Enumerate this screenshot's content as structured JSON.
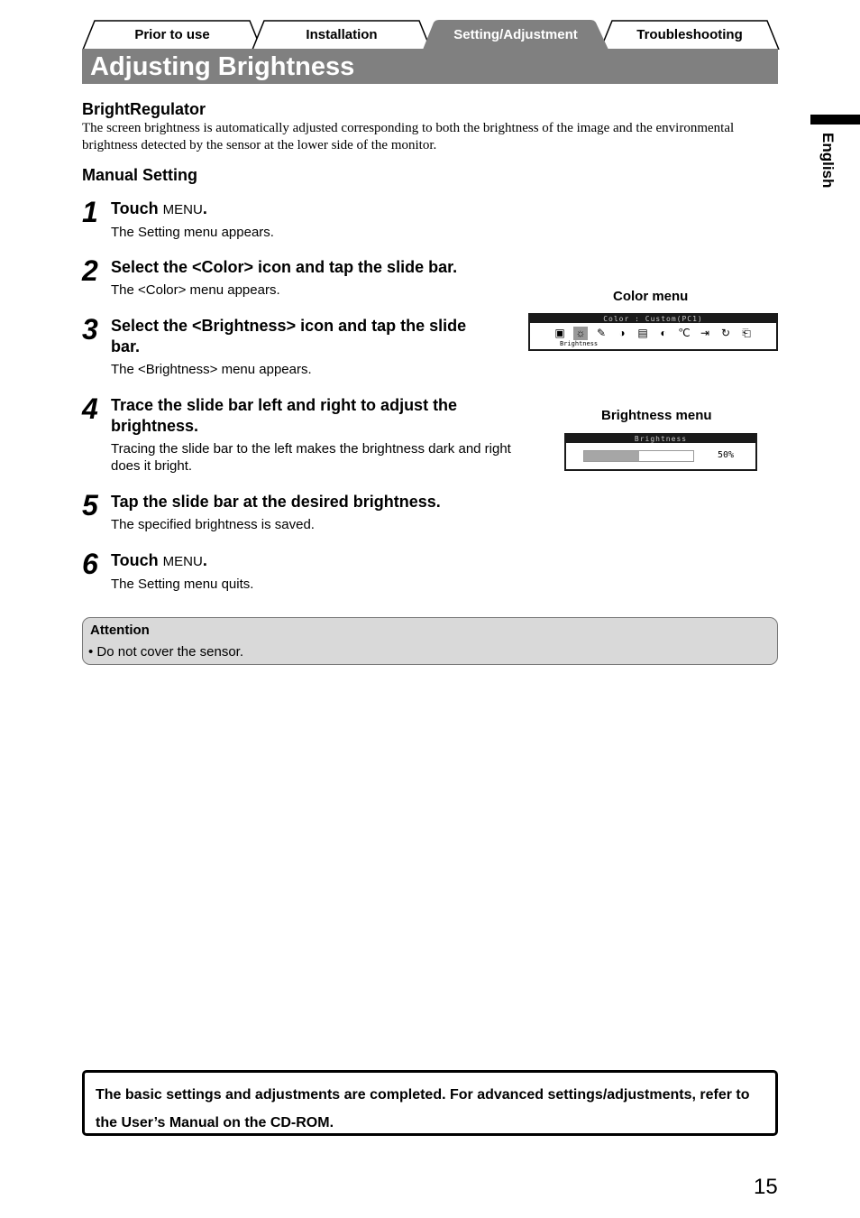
{
  "tabs": [
    {
      "label": "Prior to use",
      "active": false
    },
    {
      "label": "Installation",
      "active": false
    },
    {
      "label": "Setting/Adjustment",
      "active": true
    },
    {
      "label": "Troubleshooting",
      "active": false
    }
  ],
  "page_title": "Adjusting Brightness",
  "bright_regulator": {
    "heading": "BrightRegulator",
    "text": "The screen brightness is automatically adjusted corresponding to both the brightness of the image and the environmental brightness detected by the sensor at the lower side of the monitor."
  },
  "manual_setting": {
    "heading": "Manual Setting",
    "steps": [
      {
        "num": "1",
        "head": "Touch",
        "key": "MENU",
        "desc": "The Setting menu appears."
      },
      {
        "num": "2",
        "head": "Select the <Color> icon and tap the slide bar.",
        "desc": "The <Color> menu appears."
      },
      {
        "num": "3",
        "head": "Select the <Brightness> icon and tap the slide bar.",
        "desc": "The <Brightness> menu appears."
      },
      {
        "num": "4",
        "head": "Trace the slide bar left and right to adjust the brightness.",
        "desc": "Tracing the slide bar to the left makes the brightness dark and right does it bright."
      },
      {
        "num": "5",
        "head": "Tap the slide bar at the desired brightness.",
        "desc": "The specified brightness is saved."
      },
      {
        "num": "6",
        "head": "Touch",
        "key": "MENU",
        "desc": "The Setting menu quits."
      }
    ]
  },
  "color_menu": {
    "label": "Color menu",
    "bar_title": "Color : Custom(PC1)",
    "selected_label": "Brightness",
    "icons": [
      "mode-icon",
      "brightness-icon",
      "contrast-icon",
      "gamma-icon",
      "monitor-icon",
      "saturation-icon",
      "temperature-icon",
      "arrow-icon",
      "reset-icon",
      "return-icon"
    ]
  },
  "brightness_menu": {
    "label": "Brightness menu",
    "bar_title": "Brightness",
    "value_text": "50%",
    "value": 0.5
  },
  "attention": {
    "title": "Attention",
    "bullet": "Do not cover the sensor."
  },
  "final_note": "The basic settings and adjustments are completed. For advanced settings/adjustments, refer to the User’s Manual on the CD-ROM.",
  "side_label": "English",
  "page_number": "15"
}
